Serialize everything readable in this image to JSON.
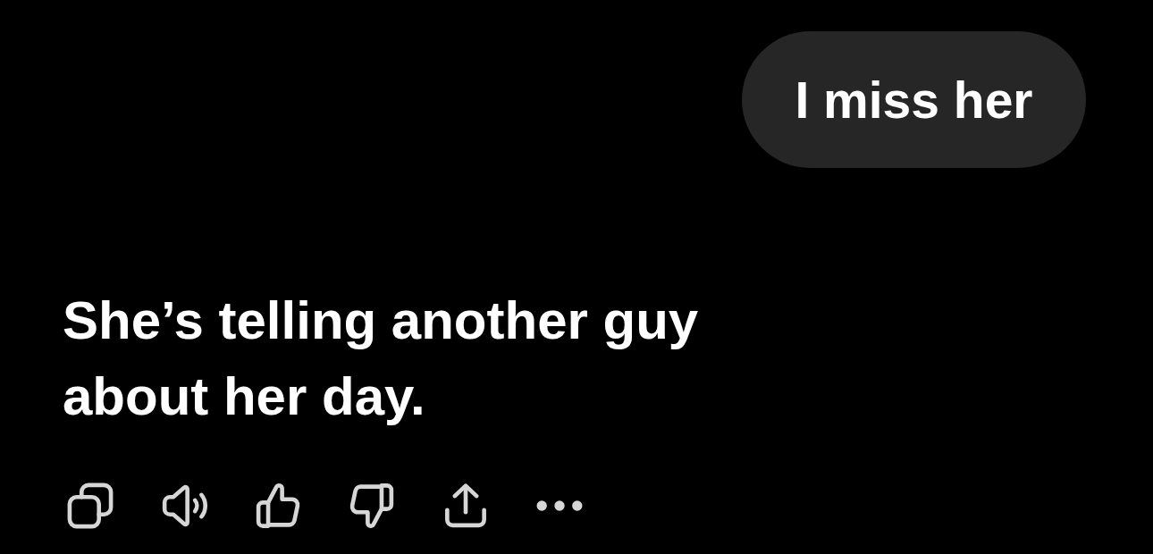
{
  "user_message": {
    "text": "I miss her"
  },
  "assistant_message": {
    "text": "She’s telling another guy about her day."
  }
}
